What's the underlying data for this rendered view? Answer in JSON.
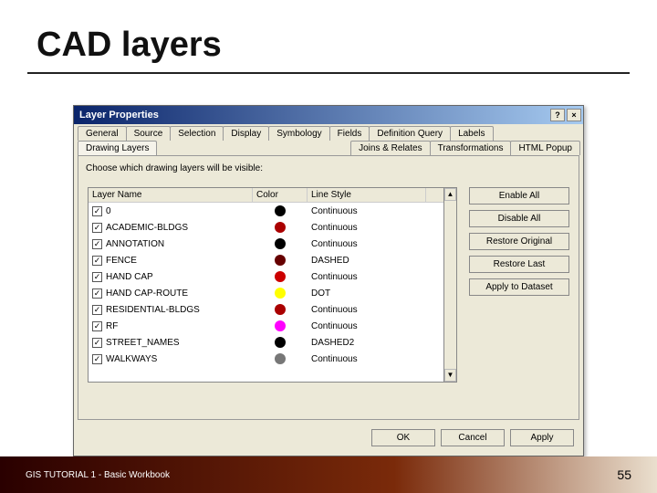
{
  "slide": {
    "title": "CAD layers"
  },
  "footer": {
    "left": "GIS TUTORIAL 1 - Basic Workbook",
    "page": "55"
  },
  "dialog": {
    "title": "Layer Properties",
    "help_label": "?",
    "close_label": "×",
    "tabsRow1": [
      "General",
      "Source",
      "Selection",
      "Display",
      "Symbology",
      "Fields",
      "Definition Query",
      "Labels"
    ],
    "tabsRow2a": "Drawing Layers",
    "tabsRow2b": [
      "Joins & Relates",
      "Transformations",
      "HTML Popup"
    ],
    "panel_desc": "Choose which drawing layers will be visible:",
    "columns": {
      "name": "Layer Name",
      "color": "Color",
      "style": "Line Style"
    },
    "rows": [
      {
        "name": "0",
        "checked": true,
        "color": "#000000",
        "style": "Continuous"
      },
      {
        "name": "ACADEMIC-BLDGS",
        "checked": true,
        "color": "#aa0000",
        "style": "Continuous"
      },
      {
        "name": "ANNOTATION",
        "checked": true,
        "color": "#000000",
        "style": "Continuous"
      },
      {
        "name": "FENCE",
        "checked": true,
        "color": "#660000",
        "style": "DASHED"
      },
      {
        "name": "HAND CAP",
        "checked": true,
        "color": "#cc0000",
        "style": "Continuous"
      },
      {
        "name": "HAND CAP-ROUTE",
        "checked": true,
        "color": "#ffff00",
        "style": "DOT"
      },
      {
        "name": "RESIDENTIAL-BLDGS",
        "checked": true,
        "color": "#aa0000",
        "style": "Continuous"
      },
      {
        "name": "RF",
        "checked": true,
        "color": "#ff00ff",
        "style": "Continuous"
      },
      {
        "name": "STREET_NAMES",
        "checked": true,
        "color": "#000000",
        "style": "DASHED2"
      },
      {
        "name": "WALKWAYS",
        "checked": true,
        "color": "#777777",
        "style": "Continuous"
      }
    ],
    "side_buttons": [
      "Enable All",
      "Disable All",
      "Restore Original",
      "Restore Last",
      "Apply to Dataset"
    ],
    "foot_buttons": {
      "ok": "OK",
      "cancel": "Cancel",
      "apply": "Apply"
    }
  }
}
